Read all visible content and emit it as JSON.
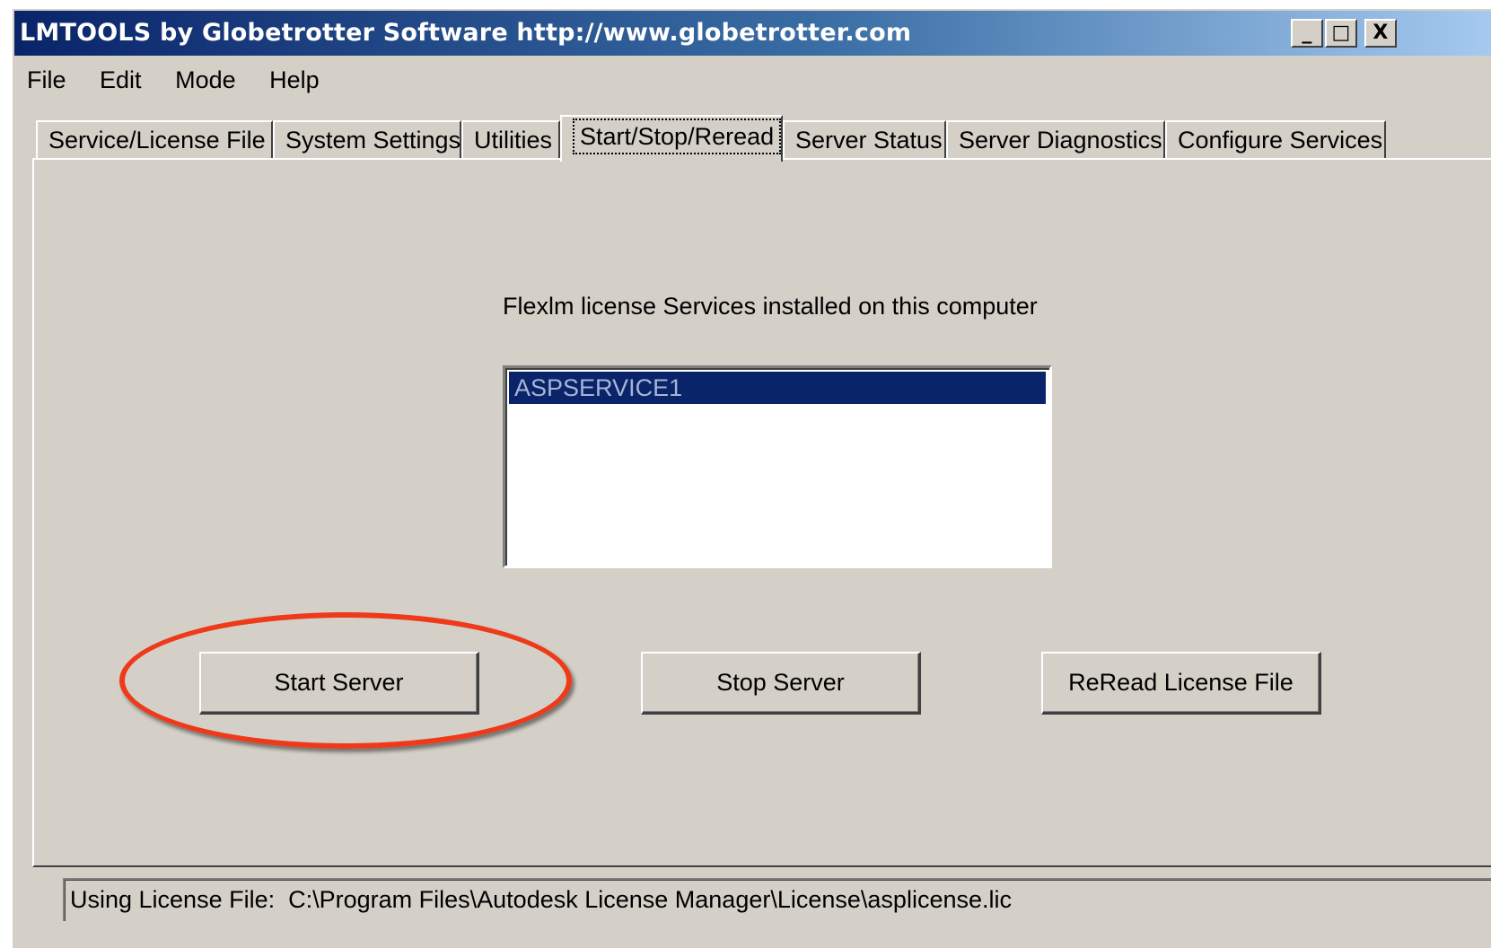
{
  "window": {
    "title": "LMTOOLS by Globetrotter Software http://www.globetrotter.com",
    "minimize_glyph": "_",
    "maximize_glyph": "□",
    "close_glyph": "X"
  },
  "menu": {
    "items": [
      "File",
      "Edit",
      "Mode",
      "Help"
    ]
  },
  "tabs": [
    {
      "label": "Service/License File"
    },
    {
      "label": "System Settings"
    },
    {
      "label": "Utilities"
    },
    {
      "label": "Start/Stop/Reread",
      "active": true
    },
    {
      "label": "Server Status"
    },
    {
      "label": "Server Diagnostics"
    },
    {
      "label": "Configure Services"
    }
  ],
  "main": {
    "services_label": "Flexlm license Services installed on this computer",
    "services": [
      {
        "name": "ASPSERVICE1",
        "selected": true
      }
    ],
    "buttons": {
      "start": "Start Server",
      "stop": "Stop Server",
      "reread": "ReRead License File"
    },
    "highlight_color": "#ee3a1a"
  },
  "status": {
    "text": "Using License File:  C:\\Program Files\\Autodesk License Manager\\License\\asplicense.lic"
  }
}
